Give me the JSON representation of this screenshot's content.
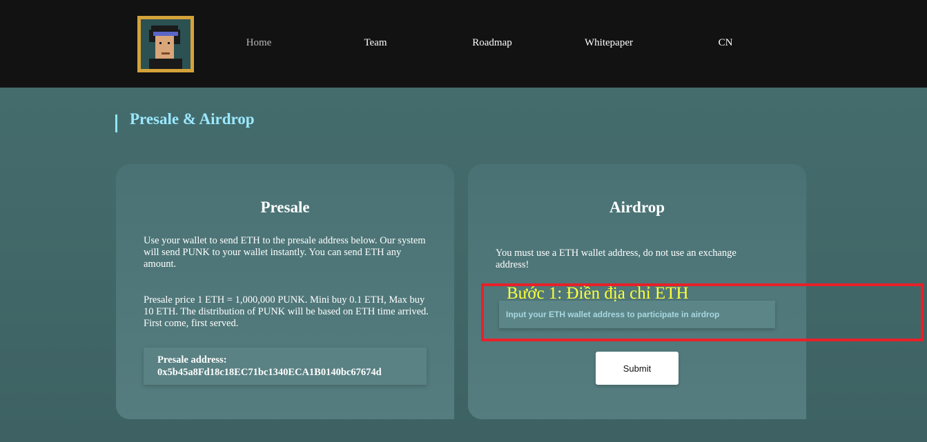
{
  "nav": {
    "items": [
      {
        "label": "Home",
        "active": true
      },
      {
        "label": "Team",
        "active": false
      },
      {
        "label": "Roadmap",
        "active": false
      },
      {
        "label": "Whitepaper",
        "active": false
      },
      {
        "label": "CN",
        "active": false
      }
    ]
  },
  "section": {
    "title": "Presale & Airdrop"
  },
  "presale": {
    "title": "Presale",
    "text1": "Use your wallet to send ETH to the presale address below. Our system will send PUNK to your wallet instantly. You can send ETH any amount.",
    "text2": "Presale price 1 ETH = 1,000,000 PUNK. Mini buy 0.1 ETH, Max buy 10 ETH. The distribution of PUNK will be based on ETH time arrived. First come, first served.",
    "address_label": "Presale address:",
    "address": "0x5b45a8Fd18c18EC71bc1340ECA1B0140bc67674d"
  },
  "airdrop": {
    "title": "Airdrop",
    "text": "You must use a ETH wallet address, do not use an exchange address!",
    "input_placeholder": "Input your ETH wallet address to participate in airdrop",
    "input_value": "",
    "submit_label": "Submit"
  },
  "annotation": {
    "text": "Bước 1: Điền địa chỉ ETH"
  },
  "colors": {
    "accent_title": "#9be9ff",
    "annotation_box": "#e8202a",
    "annotation_text": "#ffff3a",
    "logo_frame": "#d4a23a"
  }
}
